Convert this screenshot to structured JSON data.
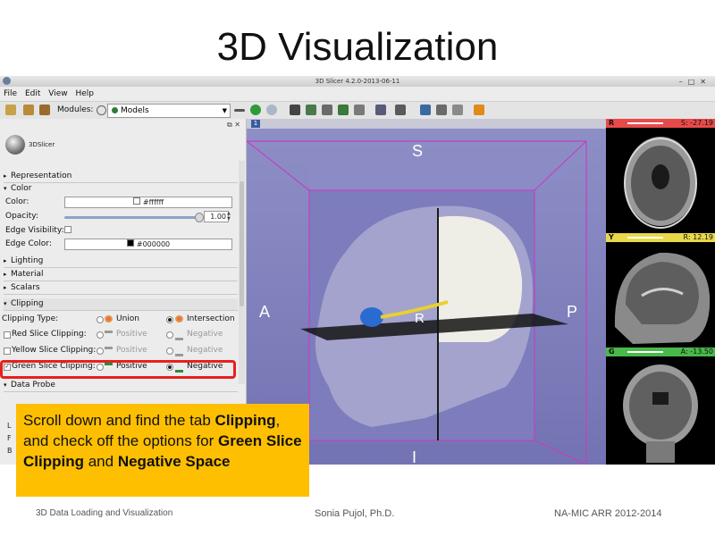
{
  "slide": {
    "title": "3D Visualization",
    "footer_left": "3D Data Loading and Visualization",
    "footer_center": "Sonia Pujol, Ph.D.",
    "footer_right": "NA-MIC ARR 2012-2014"
  },
  "window": {
    "title": "3D Slicer 4.2.0-2013-06-11",
    "menu": [
      "File",
      "Edit",
      "View",
      "Help"
    ],
    "modules_label": "Modules:",
    "module_selected": "Models"
  },
  "panel": {
    "logo_text": "3DSlicer",
    "sections": {
      "representation": "Representation",
      "color": "Color",
      "lighting": "Lighting",
      "material": "Material",
      "scalars": "Scalars",
      "clipping": "Clipping",
      "data_probe": "Data Probe"
    },
    "color_label": "Color:",
    "color_value": "#ffffff",
    "opacity_label": "Opacity:",
    "opacity_value": "1.00",
    "opacity_fraction": 1.0,
    "edge_visibility_label": "Edge Visibility:",
    "edge_color_label": "Edge Color:",
    "edge_color_value": "#000000",
    "clipping_type_label": "Clipping Type:",
    "union": "Union",
    "intersection": "Intersection",
    "red_label": "Red Slice Clipping:",
    "yellow_label": "Yellow Slice Clipping:",
    "green_label": "Green Slice Clipping:",
    "positive": "Positive",
    "negative": "Negative"
  },
  "view3d": {
    "pin": "1",
    "orientation": {
      "s": "S",
      "a": "A",
      "p": "P",
      "r": "R",
      "i": "I"
    }
  },
  "slices": [
    {
      "letter": "R",
      "value": "S: -27.19",
      "color": "#e84a4a"
    },
    {
      "letter": "Y",
      "value": "R: 12.19",
      "color": "#e8d84a"
    },
    {
      "letter": "G",
      "value": "A: -13.50",
      "color": "#4ab84a"
    }
  ],
  "callout": {
    "line1": "Scroll down and find the tab",
    "bold1": "Clipping",
    "mid": ", and check off the options for",
    "bold2": "Green Slice Clipping",
    "and": "and",
    "bold3": "Negative Space"
  },
  "left_letters": [
    "L",
    "F",
    "B"
  ]
}
